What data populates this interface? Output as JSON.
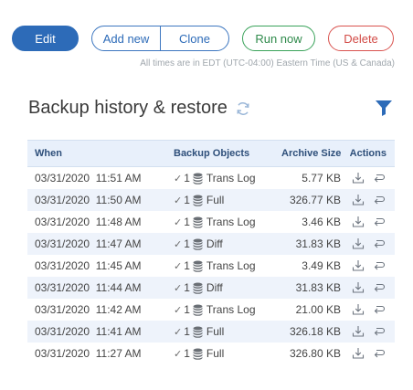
{
  "toolbar": {
    "edit_label": "Edit",
    "add_new_label": "Add new",
    "clone_label": "Clone",
    "run_now_label": "Run now",
    "delete_label": "Delete"
  },
  "timezone_note": "All times are in EDT (UTC-04:00) Eastern Time (US & Canada)",
  "section": {
    "title": "Backup history & restore"
  },
  "table": {
    "headers": {
      "when": "When",
      "objects": "Backup Objects",
      "size": "Archive Size",
      "actions": "Actions"
    },
    "rows": [
      {
        "date": "03/31/2020",
        "time": "11:51 AM",
        "count": "1",
        "type": "Trans Log",
        "size": "5.77 KB"
      },
      {
        "date": "03/31/2020",
        "time": "11:50 AM",
        "count": "1",
        "type": "Full",
        "size": "326.77 KB"
      },
      {
        "date": "03/31/2020",
        "time": "11:48 AM",
        "count": "1",
        "type": "Trans Log",
        "size": "3.46 KB"
      },
      {
        "date": "03/31/2020",
        "time": "11:47 AM",
        "count": "1",
        "type": "Diff",
        "size": "31.83 KB"
      },
      {
        "date": "03/31/2020",
        "time": "11:45 AM",
        "count": "1",
        "type": "Trans Log",
        "size": "3.49 KB"
      },
      {
        "date": "03/31/2020",
        "time": "11:44 AM",
        "count": "1",
        "type": "Diff",
        "size": "31.83 KB"
      },
      {
        "date": "03/31/2020",
        "time": "11:42 AM",
        "count": "1",
        "type": "Trans Log",
        "size": "21.00 KB"
      },
      {
        "date": "03/31/2020",
        "time": "11:41 AM",
        "count": "1",
        "type": "Full",
        "size": "326.18 KB"
      },
      {
        "date": "03/31/2020",
        "time": "11:27 AM",
        "count": "1",
        "type": "Full",
        "size": "326.80 KB"
      }
    ]
  },
  "icons": {
    "refresh": "refresh-icon",
    "filter": "filter-icon",
    "check": "check-icon",
    "database": "database-icon",
    "download": "download-icon",
    "restore": "restore-icon"
  },
  "colors": {
    "primary": "#2d6bb8",
    "success": "#3aa35a",
    "danger": "#d9534f",
    "header_bg": "#e8f0fb",
    "stripe_bg": "#eef3fb"
  }
}
